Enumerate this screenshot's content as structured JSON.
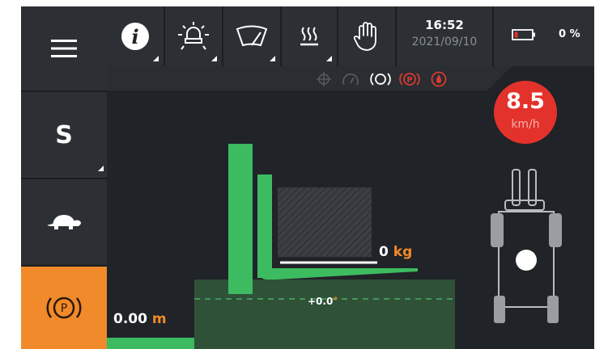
{
  "statusbar": {
    "time": "16:52",
    "date": "2021/09/10",
    "battery_percent": "0 %"
  },
  "sidebar": {
    "gear_label": "S"
  },
  "speed": {
    "value": "8.5",
    "unit": "km/h"
  },
  "forks": {
    "load_value": "0",
    "load_unit": "kg",
    "tilt_value": "+0.0",
    "tilt_unit": "°",
    "height_value": "0.00",
    "height_unit": "m"
  },
  "colors": {
    "accent_orange": "#f08a2a",
    "fork_green": "#3dbb60",
    "speed_red": "#e3322b",
    "warning_red": "#d93b30",
    "panel": "#2c3035",
    "background": "#202327"
  },
  "icons": [
    "menu-icon",
    "info-icon",
    "work-light-icon",
    "wiper-icon",
    "heater-icon",
    "hand-control-icon",
    "battery-icon",
    "turtle-icon",
    "parking-brake-icon",
    "target-icon",
    "gauge-icon",
    "brake-circle-icon",
    "parking-warning-icon",
    "oil-warning-icon"
  ]
}
